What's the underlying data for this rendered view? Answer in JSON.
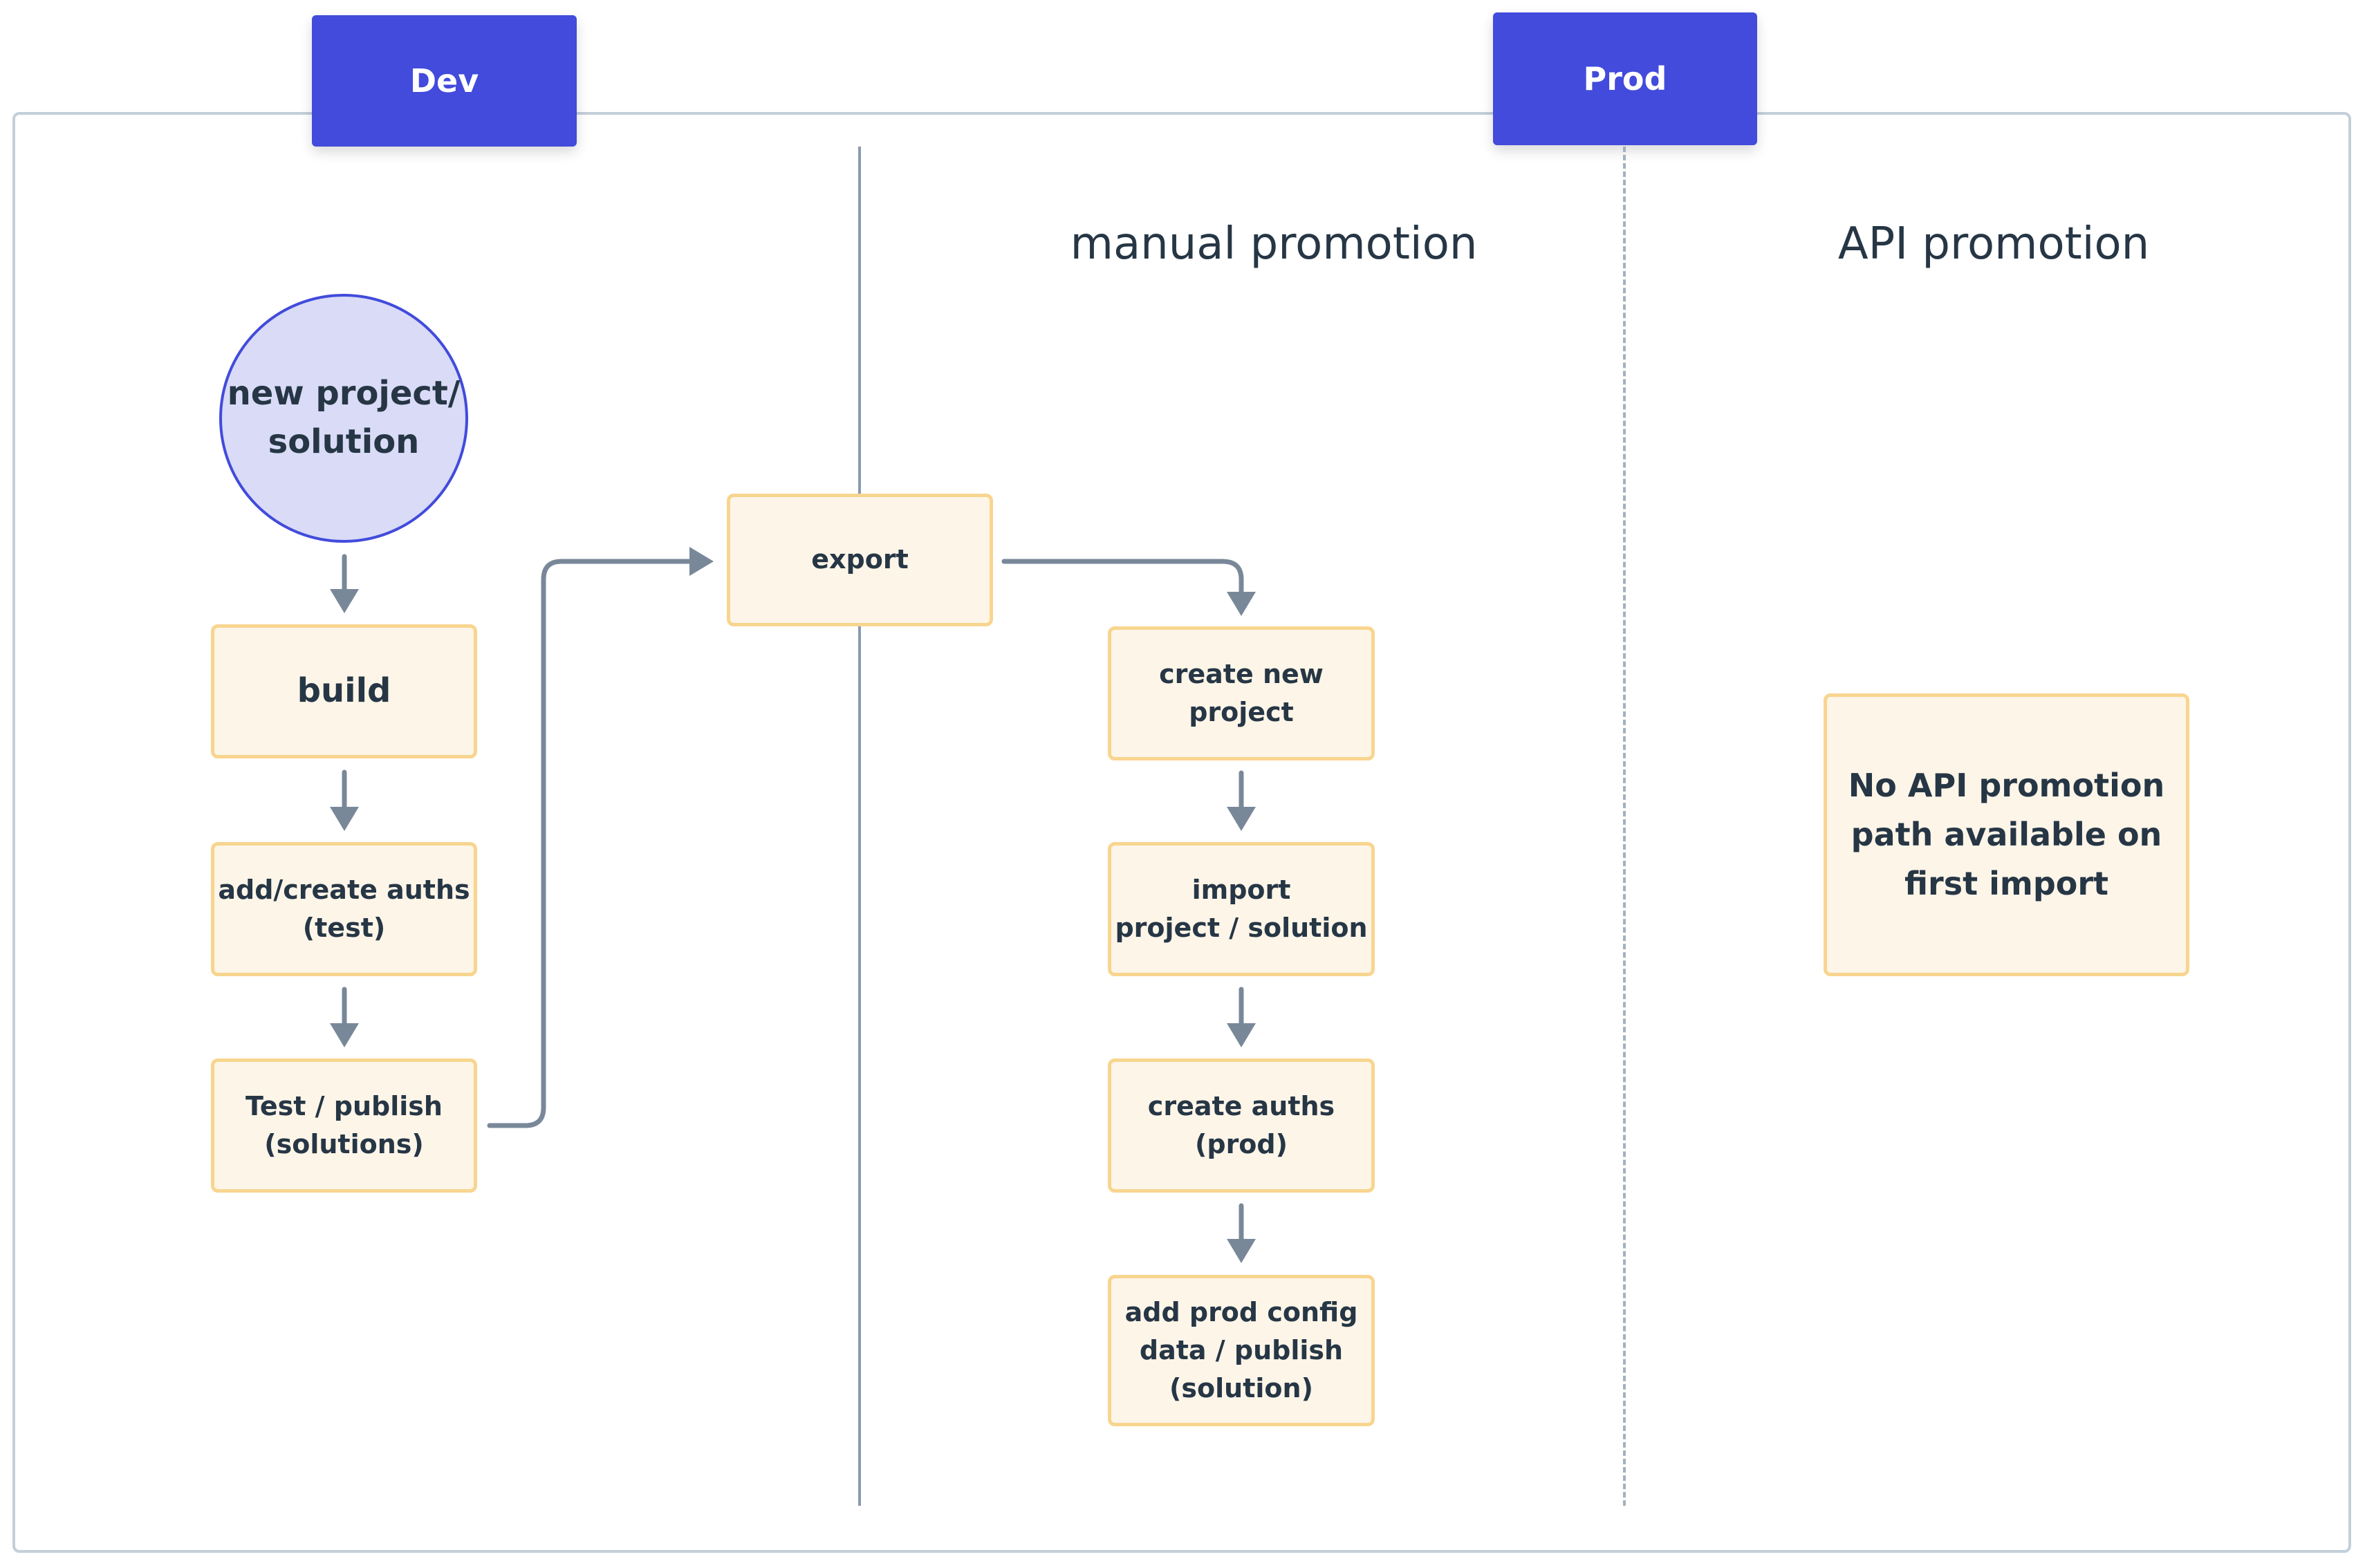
{
  "environments": {
    "dev": "Dev",
    "prod": "Prod"
  },
  "sections": {
    "manual": "manual promotion",
    "api": "API promotion"
  },
  "dev_flow": {
    "start": "new project/\nsolution",
    "steps": [
      "build",
      "add/create auths\n(test)",
      "Test / publish\n(solutions)"
    ]
  },
  "export_step": "export",
  "manual_flow": {
    "steps": [
      "create new\nproject",
      "import\nproject / solution",
      "create auths\n(prod)",
      "add prod config\ndata / publish\n(solution)"
    ]
  },
  "api_note": "No API promotion\npath available on\nfirst import",
  "colors": {
    "env_tab": "#424bdb",
    "start_fill": "#d9dbf7",
    "node_fill": "#fdf5e8",
    "node_border": "#f8d58f",
    "arrow": "#798899",
    "text": "#263645"
  }
}
